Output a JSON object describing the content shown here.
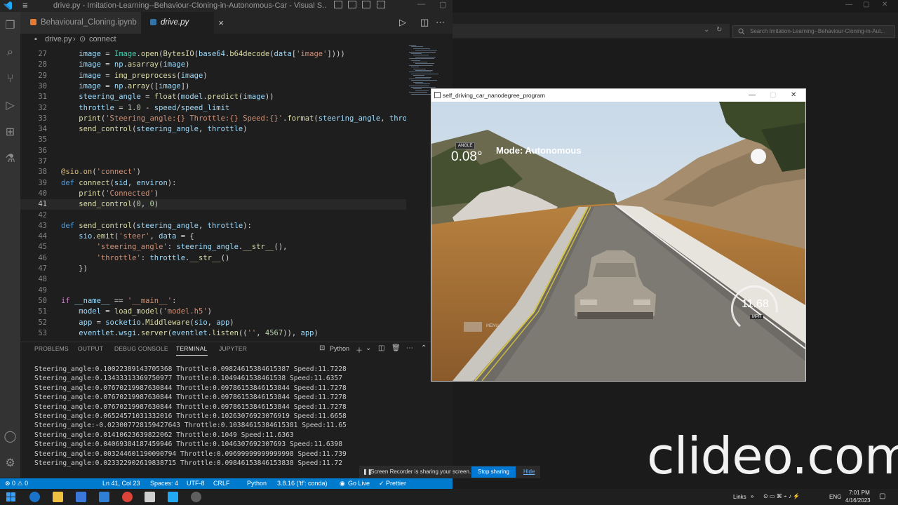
{
  "vscode": {
    "title": "drive.py - Imitation-Learning--Behaviour-Cloning-in-Autonomous-Car - Visual S...",
    "tabs": [
      {
        "label": "Behavioural_Cloning.ipynb"
      },
      {
        "label": "drive.py",
        "close": "×"
      }
    ],
    "breadcrumb": {
      "file": "drive.py",
      "sep": "›",
      "symbol": "connect"
    },
    "code_lines": [
      {
        "num": "27",
        "html": "    image = Image.open(BytesIO(base64.b64decode(data['image'])))"
      },
      {
        "num": "28",
        "html": "    image = np.asarray(image)"
      },
      {
        "num": "29",
        "html": "    image = img_preprocess(image)"
      },
      {
        "num": "30",
        "html": "    image = np.array([image])"
      },
      {
        "num": "31",
        "html": "    steering_angle = float(model.predict(image))"
      },
      {
        "num": "32",
        "html": "    throttle = 1.0 - speed/speed_limit"
      },
      {
        "num": "33",
        "html": "    print('Steering_angle:{} Throttle:{} Speed:{}'.format(steering_angle, throt"
      },
      {
        "num": "34",
        "html": "    send_control(steering_angle, throttle)"
      },
      {
        "num": "35",
        "html": ""
      },
      {
        "num": "36",
        "html": ""
      },
      {
        "num": "37",
        "html": ""
      },
      {
        "num": "38",
        "html": "@sio.on('connect')"
      },
      {
        "num": "39",
        "html": "def connect(sid, environ):"
      },
      {
        "num": "40",
        "html": "    print('Connected')"
      },
      {
        "num": "41",
        "html": "    send_control(0, 0)"
      },
      {
        "num": "42",
        "html": ""
      },
      {
        "num": "43",
        "html": "def send_control(steering_angle, throttle):"
      },
      {
        "num": "44",
        "html": "    sio.emit('steer', data = {"
      },
      {
        "num": "45",
        "html": "        'steering_angle': steering_angle.__str__(),"
      },
      {
        "num": "46",
        "html": "        'throttle': throttle.__str__()"
      },
      {
        "num": "47",
        "html": "    })"
      },
      {
        "num": "48",
        "html": ""
      },
      {
        "num": "49",
        "html": ""
      },
      {
        "num": "50",
        "html": "if __name__ == '__main__':"
      },
      {
        "num": "51",
        "html": "    model = load_model('model.h5')"
      },
      {
        "num": "52",
        "html": "    app = socketio.Middleware(sio, app)"
      },
      {
        "num": "53",
        "html": "    eventlet.wsgi.server(eventlet.listen(('', 4567)), app)"
      }
    ],
    "panel": {
      "tabs": [
        "PROBLEMS",
        "OUTPUT",
        "DEBUG CONSOLE",
        "TERMINAL",
        "JUPYTER"
      ],
      "shell": "Python",
      "terminal_lines": [
        "Steering_angle:0.10022389143705368 Throttle:0.09824615384615387 Speed:11.7228",
        "Steering_angle:0.13433313369750977 Throttle:0.1049461538461538 Speed:11.6357",
        "Steering_angle:0.07670219987630844 Throttle:0.09786153846153844 Speed:11.7278",
        "Steering_angle:0.07670219987630844 Throttle:0.09786153846153844 Speed:11.7278",
        "Steering_angle:0.07670219987630844 Throttle:0.09786153846153844 Speed:11.7278",
        "Steering_angle:0.06524571031332016 Throttle:0.10263076923076919 Speed:11.6658",
        "Steering_angle:-0.023007728159427643 Throttle:0.10384615384615381 Speed:11.65",
        "Steering_angle:0.01410623639822062 Throttle:0.1049 Speed:11.6363",
        "Steering_angle:0.04069384187459946 Throttle:0.1046307692307693 Speed:11.6398",
        "Steering_angle:0.003244601190090794 Throttle:0.09699999999999998 Speed:11.739",
        "Steering_angle:0.023322902619838715 Throttle:0.09846153846153838 Speed:11.72"
      ]
    },
    "status": {
      "problems": "⊗ 0 ⚠ 0",
      "position": "Ln 41, Col 23",
      "spaces": "Spaces: 4",
      "encoding": "UTF-8",
      "eol": "CRLF",
      "language": "Python",
      "interpreter": "3.8.16 ('tf': conda)",
      "golive": "Go Live",
      "prettier": "✓ Prettier"
    }
  },
  "browser": {
    "search_placeholder": "Search Imitation-Learning--Behaviour-Cloning-in-Aut..."
  },
  "simulator": {
    "title": "self_driving_car_nanodegree_program",
    "angle_label": "ANGLE",
    "angle_value": "0.08°",
    "mode": "Mode: Autonomous",
    "speed_value": "11.68",
    "speed_unit": "MPH",
    "menu_label": "MENU"
  },
  "share_banner": {
    "message": "Screen Recorder is sharing your screen.",
    "stop": "Stop sharing",
    "hide": "Hide"
  },
  "watermark": "clideo.com",
  "taskbar": {
    "links": "Links",
    "lang": "ENG",
    "time": "7:01 PM",
    "date": "4/16/2023"
  },
  "colors": {
    "vscode_blue": "#007acc",
    "stop_button": "#0078d4"
  }
}
